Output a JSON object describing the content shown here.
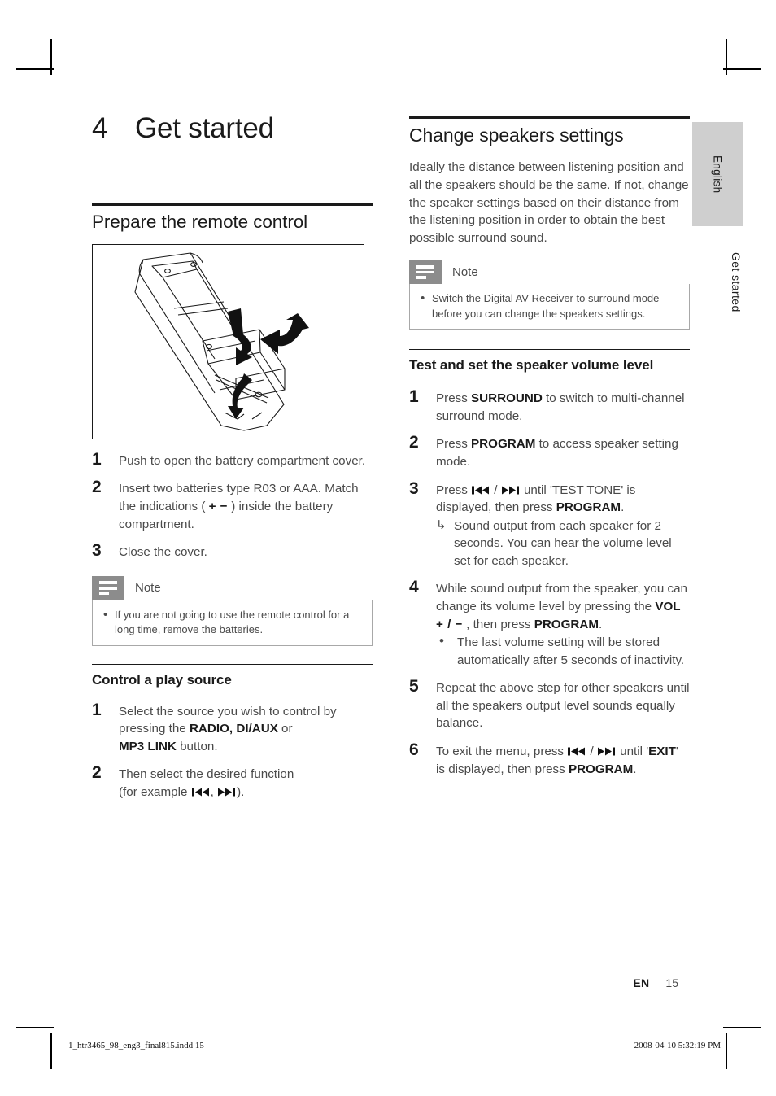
{
  "chapter": {
    "number": "4",
    "title": "Get started"
  },
  "side_tab": {
    "language": "English",
    "chapter_label": "Get started"
  },
  "left_column": {
    "section_title": "Prepare the remote control",
    "figure_alt": "remote-control-battery-compartment-diagram",
    "steps": [
      {
        "num": "1",
        "text": "Push to open the battery compartment cover."
      },
      {
        "num": "2",
        "text": "Insert two batteries type R03 or AAA. Match the indications ( + − ) inside the battery compartment."
      },
      {
        "num": "3",
        "text": "Close the cover."
      }
    ],
    "note": {
      "title": "Note",
      "items": [
        "If you are not going to use the remote control for a long time, remove the batteries."
      ]
    },
    "subsection_title": "Control a play source",
    "sub_steps": [
      {
        "num": "1",
        "text": "Select the source you wish to control by pressing the RADIO, DI/AUX or MP3 LINK button."
      },
      {
        "num": "2",
        "text": "Then select the desired function (for example ⏮ , ⏭ )."
      }
    ]
  },
  "right_column": {
    "section_title": "Change speakers settings",
    "intro": "Ideally the distance between listening position and all the speakers should be the same.  If not, change the speaker settings based on their distance from the listening position in order to obtain the best possible surround sound.",
    "note": {
      "title": "Note",
      "items": [
        "Switch the Digital AV Receiver to surround mode before you can change the speakers settings."
      ]
    },
    "subsection_title": "Test and set the speaker volume level",
    "steps": [
      {
        "num": "1",
        "text": "Press SURROUND to switch to multi-channel surround mode."
      },
      {
        "num": "2",
        "text": "Press PROGRAM to access speaker setting mode."
      },
      {
        "num": "3",
        "text": "Press ⏮ / ⏭ until 'TEST TONE' is displayed, then press PROGRAM.",
        "substeps": [
          {
            "marker": "arrow",
            "text": "Sound output from each speaker for 2 seconds.  You can hear the volume level set for each speaker."
          }
        ]
      },
      {
        "num": "4",
        "text": "While sound output from the speaker, you can change its volume level by pressing the VOL + / − , then press PROGRAM.",
        "substeps": [
          {
            "marker": "dot",
            "text": "The last volume setting will be stored automatically after 5 seconds of inactivity."
          }
        ]
      },
      {
        "num": "5",
        "text": "Repeat the above step for other speakers until all the speakers output level sounds equally balance."
      },
      {
        "num": "6",
        "text": "To exit the menu, press ⏮ / ⏭ until 'EXIT' is displayed, then press PROGRAM."
      }
    ]
  },
  "footer": {
    "language_code": "EN",
    "page_number": "15",
    "imprint_file": "1_htr3465_98_eng3_final815.indd   15",
    "imprint_timestamp": "2008-04-10   5:32:19 PM"
  },
  "colors": {
    "text_primary": "#1a1a1a",
    "text_body": "#4a4a4a",
    "note_icon_bg": "#8c8c8c",
    "note_border": "#a8a8a8",
    "tab_bg": "#cfcfcf"
  }
}
